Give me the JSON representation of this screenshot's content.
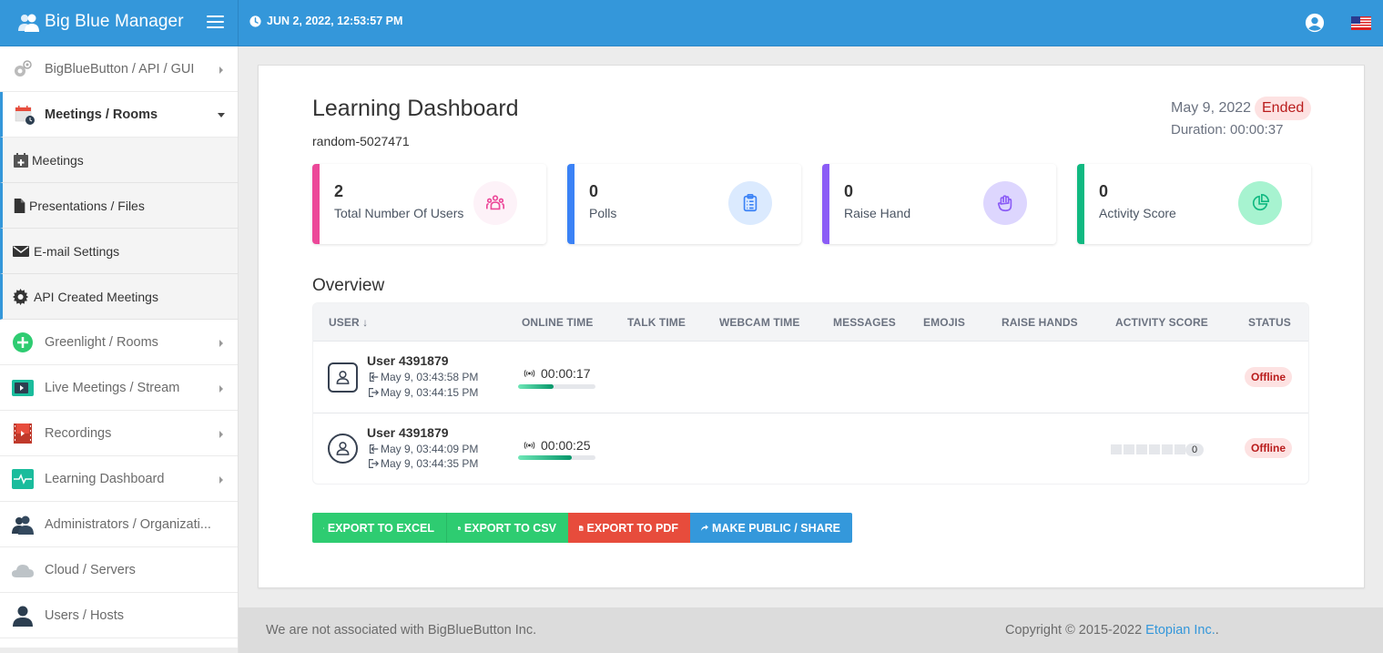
{
  "app": {
    "title": "Big Blue Manager",
    "datetime": "JUN 2, 2022, 12:53:57 PM"
  },
  "sidebar": {
    "items": [
      {
        "label": "BigBlueButton / API / GUI",
        "icon": "gears-icon"
      },
      {
        "label": "Meetings / Rooms",
        "icon": "calendar-clock-icon",
        "expanded": true
      },
      {
        "label": "Greenlight / Rooms",
        "icon": "plus-circle-icon"
      },
      {
        "label": "Live Meetings / Stream",
        "icon": "tv-play-icon"
      },
      {
        "label": "Recordings",
        "icon": "film-icon"
      },
      {
        "label": "Learning Dashboard",
        "icon": "pulse-icon"
      },
      {
        "label": "Administrators / Organizati...",
        "icon": "users-icon"
      },
      {
        "label": "Cloud / Servers",
        "icon": "cloud-icon"
      },
      {
        "label": "Users / Hosts",
        "icon": "user-icon"
      }
    ],
    "subitems": [
      {
        "label": "Meetings",
        "icon": "calendar-plus-icon"
      },
      {
        "label": "Presentations / Files",
        "icon": "file-icon"
      },
      {
        "label": "E-mail Settings",
        "icon": "envelope-icon"
      },
      {
        "label": "API Created Meetings",
        "icon": "cog-icon"
      }
    ]
  },
  "dashboard": {
    "title": "Learning Dashboard",
    "meeting_name": "random-5027471",
    "date": "May 9, 2022",
    "status": "Ended",
    "duration": "Duration: 00:00:37",
    "colors": {
      "pink": "#ec4899",
      "blue": "#3b82f6",
      "purple": "#8b5cf6",
      "green": "#10b981",
      "danger": "#b91c1c"
    },
    "stats": [
      {
        "value": "2",
        "label": "Total Number Of Users",
        "icon": "users-group-icon"
      },
      {
        "value": "0",
        "label": "Polls",
        "icon": "clipboard-list-icon"
      },
      {
        "value": "0",
        "label": "Raise Hand",
        "icon": "hand-icon"
      },
      {
        "value": "0",
        "label": "Activity Score",
        "icon": "pie-chart-icon"
      }
    ],
    "overview_title": "Overview",
    "columns": [
      "USER ↓",
      "ONLINE TIME",
      "TALK TIME",
      "WEBCAM TIME",
      "MESSAGES",
      "EMOJIS",
      "RAISE HANDS",
      "ACTIVITY SCORE",
      "STATUS"
    ],
    "rows": [
      {
        "name": "User 4391879",
        "joined": "May 9, 03:43:58 PM",
        "left": "May 9, 03:44:15 PM",
        "online_time": "00:00:17",
        "online_fraction": 0.46,
        "talk_time": "",
        "webcam_time": "",
        "messages": "",
        "emojis": "",
        "raise_hands": "",
        "activity_score": "",
        "status": "Offline"
      },
      {
        "name": "User 4391879",
        "joined": "May 9, 03:44:09 PM",
        "left": "May 9, 03:44:35 PM",
        "online_time": "00:00:25",
        "online_fraction": 0.69,
        "talk_time": "",
        "webcam_time": "",
        "messages": "",
        "emojis": "",
        "raise_hands": "",
        "activity_score": "0",
        "status": "Offline"
      }
    ],
    "buttons": {
      "excel": "EXPORT TO EXCEL",
      "csv": "EXPORT TO CSV",
      "pdf": "EXPORT TO PDF",
      "share": "MAKE PUBLIC / SHARE"
    }
  },
  "footer": {
    "disclaimer": "We are not associated with BigBlueButton Inc.",
    "copyright": "Copyright © 2015-2022 ",
    "company": "Etopian Inc.",
    "suffix": "."
  }
}
